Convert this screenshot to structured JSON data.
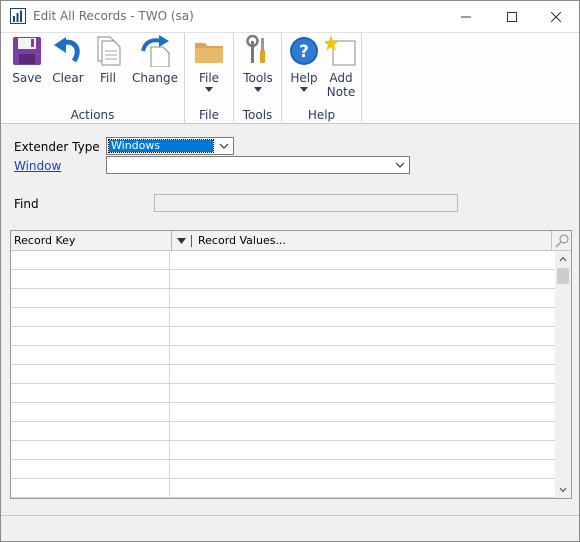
{
  "window": {
    "title": "Edit All Records  -  TWO (sa)"
  },
  "ribbon": {
    "groups": [
      {
        "label": "Actions"
      },
      {
        "label": "File"
      },
      {
        "label": "Tools"
      },
      {
        "label": "Help"
      }
    ],
    "buttons": {
      "save": "Save",
      "clear": "Clear",
      "fill": "Fill",
      "change": "Change",
      "file": "File",
      "tools": "Tools",
      "help": "Help",
      "add_note_line1": "Add",
      "add_note_line2": "Note"
    }
  },
  "form": {
    "extender_type_label": "Extender Type",
    "extender_type_value": "Windows",
    "window_label": "Window",
    "window_value": "",
    "find_label": "Find",
    "find_value": ""
  },
  "grid": {
    "columns": [
      "Record Key",
      "Record Values..."
    ],
    "rows": [
      "",
      "",
      "",
      "",
      "",
      "",
      "",
      "",
      "",
      "",
      "",
      "",
      ""
    ]
  },
  "colors": {
    "accent": "#0078d7",
    "link": "#1a3fcf",
    "ribbon_text": "#2c3b58"
  }
}
